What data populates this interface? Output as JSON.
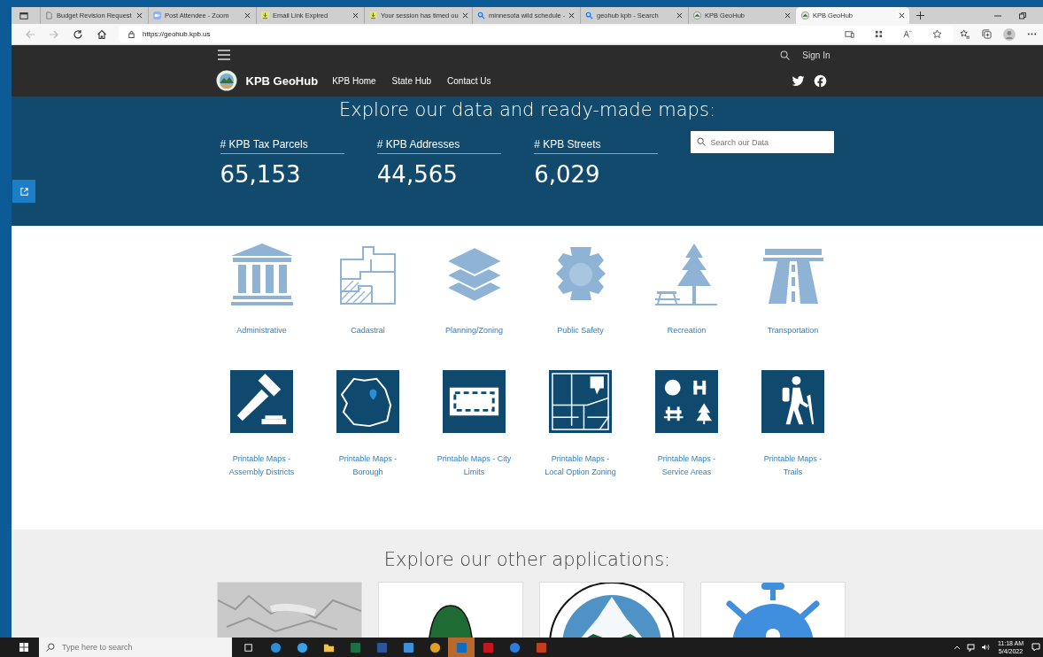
{
  "browser": {
    "tabs": [
      {
        "title": "Budget Revision Request",
        "kind": "page",
        "selected": false
      },
      {
        "title": "Post Attendee - Zoom",
        "kind": "video",
        "selected": false
      },
      {
        "title": "Email Link Expired",
        "kind": "download",
        "selected": false
      },
      {
        "title": "Your session has timed ou",
        "kind": "download",
        "selected": false
      },
      {
        "title": "minnesota wild schedule -",
        "kind": "search",
        "selected": false
      },
      {
        "title": "geohub kpb - Search",
        "kind": "search",
        "selected": false
      },
      {
        "title": "KPB GeoHub",
        "kind": "seal",
        "selected": false
      },
      {
        "title": "KPB GeoHub",
        "kind": "seal",
        "selected": true
      }
    ],
    "url": "https://geohub.kpb.us"
  },
  "header": {
    "sign_in": "Sign In",
    "site_title": "KPB GeoHub",
    "nav": [
      "KPB Home",
      "State Hub",
      "Contact Us"
    ]
  },
  "banner": {
    "heading": "Explore our data and ready-made maps:",
    "stats": [
      {
        "label": "# KPB Tax Parcels",
        "value": "65,153"
      },
      {
        "label": "# KPB Addresses",
        "value": "44,565"
      },
      {
        "label": "# KPB Streets",
        "value": "6,029"
      }
    ],
    "search": {
      "placeholder": "Search our Data"
    }
  },
  "categories": [
    {
      "label": "Administrative",
      "kind": "building"
    },
    {
      "label": "Cadastral",
      "kind": "parcels"
    },
    {
      "label": "Planning/Zoning",
      "kind": "layers"
    },
    {
      "label": "Public Safety",
      "kind": "badge"
    },
    {
      "label": "Recreation",
      "kind": "tree"
    },
    {
      "label": "Transportation",
      "kind": "road"
    }
  ],
  "printable_maps": [
    {
      "label": "Printable Maps - Assembly Districts",
      "kind": "gavel"
    },
    {
      "label": "Printable Maps - Borough",
      "kind": "outline"
    },
    {
      "label": "Printable Maps - City Limits",
      "kind": "frame"
    },
    {
      "label": "Printable Maps - Local Option Zoning",
      "kind": "map"
    },
    {
      "label": "Printable Maps - Service Areas",
      "kind": "services"
    },
    {
      "label": "Printable Maps - Trails",
      "kind": "hiker"
    }
  ],
  "other_apps": {
    "heading": "Explore our other applications:",
    "cards": [
      {
        "kind": "terrain"
      },
      {
        "kind": "land"
      },
      {
        "kind": "seal"
      },
      {
        "kind": "virus"
      }
    ]
  },
  "taskbar": {
    "search": {
      "placeholder": "Type here to search"
    },
    "apps": [
      {
        "kind": "taskview",
        "selected": false
      },
      {
        "kind": "edge",
        "selected": false
      },
      {
        "kind": "ie",
        "selected": false
      },
      {
        "kind": "folder",
        "selected": false
      },
      {
        "kind": "sheet",
        "selected": false
      },
      {
        "kind": "doc",
        "selected": false
      },
      {
        "kind": "photos",
        "selected": false
      },
      {
        "kind": "chrome",
        "selected": false
      },
      {
        "kind": "mail",
        "selected": true
      },
      {
        "kind": "pdf",
        "selected": false
      },
      {
        "kind": "bluecircle",
        "selected": false
      },
      {
        "kind": "slides",
        "selected": false
      }
    ],
    "time": "11:18 AM",
    "date": "5/4/2022"
  }
}
